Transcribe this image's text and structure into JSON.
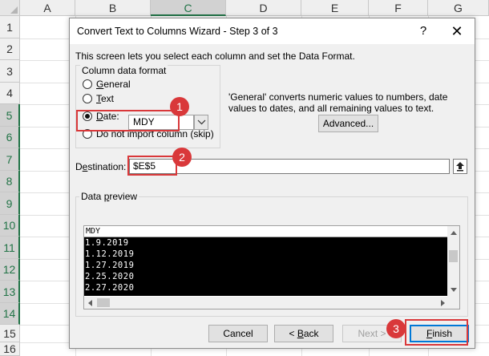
{
  "spreadsheet": {
    "columns": [
      "A",
      "B",
      "C",
      "D",
      "E",
      "F",
      "G"
    ],
    "active_column": "C",
    "rows": [
      "1",
      "2",
      "3",
      "4",
      "5",
      "6",
      "7",
      "8",
      "9",
      "10",
      "11",
      "12",
      "13",
      "14",
      "15",
      "16"
    ],
    "active_rows": [
      "5",
      "6",
      "7",
      "8",
      "9",
      "10",
      "11",
      "12",
      "13",
      "14"
    ],
    "accent_color": "#217346"
  },
  "dialog": {
    "title": "Convert Text to Columns Wizard - Step 3 of 3",
    "help_label": "?",
    "close_label": "✕",
    "intro": "This screen lets you select each column and set the Data Format.",
    "format_group": {
      "legend": "Column data format",
      "options": [
        {
          "label": "General",
          "mnemonic": "G",
          "rest": "eneral",
          "selected": false
        },
        {
          "label": "Text",
          "mnemonic": "T",
          "rest": "ext",
          "selected": false
        },
        {
          "label": "Date:",
          "mnemonic": "D",
          "rest": "ate:",
          "selected": true
        },
        {
          "label": "Do not import column (skip)",
          "mnemonic": "",
          "rest": "Do not import column (skip)",
          "selected": false
        }
      ],
      "date_format": "MDY"
    },
    "description": "'General' converts numeric values to numbers, date values to dates, and all remaining values to text.",
    "advanced_label": "Advanced...",
    "destination": {
      "label_pre": "D",
      "label_mnemonic": "e",
      "label_post": "stination:",
      "value": "$E$5"
    },
    "preview": {
      "legend_pre": "Data ",
      "legend_mnemonic": "p",
      "legend_post": "review",
      "header": "MDY",
      "lines": [
        "1.9.2019",
        "1.12.2019",
        "1.27.2019",
        "2.25.2020",
        "2.27.2020"
      ]
    },
    "buttons": {
      "cancel": "Cancel",
      "back_pre": "< ",
      "back_mnemonic": "B",
      "back_post": "ack",
      "next": "Next >",
      "finish_mnemonic": "F",
      "finish_post": "inish"
    }
  },
  "callouts": {
    "step1": "1",
    "step2": "2",
    "step3": "3",
    "color": "#d9383a"
  }
}
